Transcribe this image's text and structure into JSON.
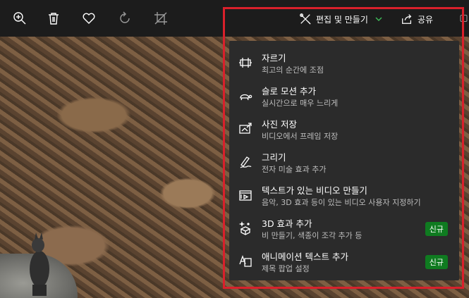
{
  "toolbar": {
    "edit_create_label": "편집 및 만들기",
    "share_label": "공유"
  },
  "menu": {
    "items": [
      {
        "title": "자르기",
        "subtitle": "최고의 순간에 조점",
        "icon": "trim-icon",
        "badge": ""
      },
      {
        "title": "슬로 모션 추가",
        "subtitle": "실시간으로 매우 느리게",
        "icon": "turtle-icon",
        "badge": ""
      },
      {
        "title": "사진 저장",
        "subtitle": "비디오에서 프레임 저장",
        "icon": "save-photo-icon",
        "badge": ""
      },
      {
        "title": "그리기",
        "subtitle": "전자 미술 효과 추가",
        "icon": "pen-draw-icon",
        "badge": ""
      },
      {
        "title": "텍스트가 있는 비디오 만들기",
        "subtitle": "음악, 3D 효과 등이 있는 비디오 사용자 지정하기",
        "icon": "video-text-icon",
        "badge": ""
      },
      {
        "title": "3D 효과 추가",
        "subtitle": "비 만들기, 색종이 조각 추가 등",
        "icon": "3d-effects-icon",
        "badge": "신규"
      },
      {
        "title": "애니메이션 텍스트 추가",
        "subtitle": "제목 팝업 설정",
        "icon": "animated-text-icon",
        "badge": "신규"
      }
    ]
  },
  "colors": {
    "toolbar_bg": "#1c1c1c",
    "menu_bg": "#2b2b2b",
    "highlight": "#d9202b",
    "badge": "#0f7b20",
    "accent": "#3fbf5a"
  }
}
